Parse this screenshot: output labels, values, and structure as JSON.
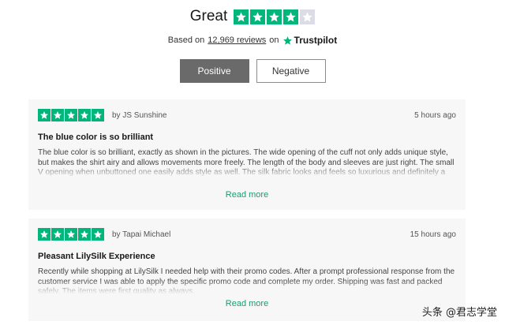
{
  "summary": {
    "rating_word": "Great",
    "stars": [
      1,
      1,
      1,
      1,
      0.5
    ],
    "based_on": "Based on",
    "review_count": "12,969 reviews",
    "on_word": "on",
    "brand": "Trustpilot"
  },
  "filters": {
    "positive_label": "Positive",
    "negative_label": "Negative",
    "selected": "Positive"
  },
  "reviews": [
    {
      "stars": 5,
      "author": "by JS Sunshine",
      "time": "5 hours ago",
      "title": "The blue color is so brilliant",
      "body": "The blue color is so brilliant, exactly as shown in the pictures. The wide opening of the cuff not only adds unique style, but makes the shirt airy and allows movements more freely. The length of the body and sleeves are just right. The small V opening when unbuttoned one easily adds style as well. The silk fabric looks and feels so luxurious and definitely a timeless piece.",
      "read_more": "Read more"
    },
    {
      "stars": 5,
      "author": "by Tapai Michael",
      "time": "15 hours ago",
      "title": "Pleasant LilySilk Experience",
      "body": "Recently while shopping at LilySilk I needed help with their promo codes. After a prompt professional response from the customer service I was able to apply the specific promo code and complete my order. Shipping was fast and packed safely. The items were first quality as always.",
      "read_more": "Read more"
    }
  ],
  "watermark": "头条 @君志学堂",
  "colors": {
    "star_green": "#00b67a",
    "star_empty": "#dcdce6",
    "link_green": "#1a9c6e",
    "active_button": "#6a6a6a",
    "card_bg": "#f7f7f7"
  }
}
